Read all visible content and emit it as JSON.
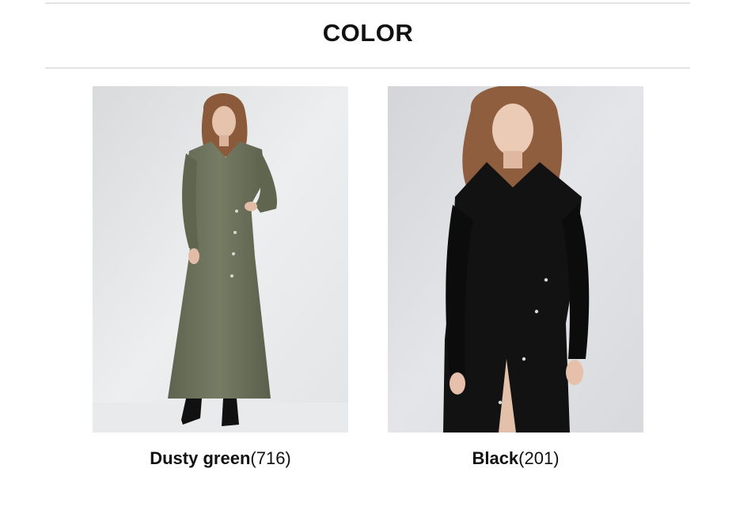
{
  "section": {
    "title": "COLOR"
  },
  "colors": [
    {
      "name": "Dusty green",
      "count": "(716)",
      "swatch": "#6b7058",
      "background": "#e4e6e8"
    },
    {
      "name": "Black",
      "count": "(201)",
      "swatch": "#111111",
      "background": "#dcdde0"
    }
  ]
}
